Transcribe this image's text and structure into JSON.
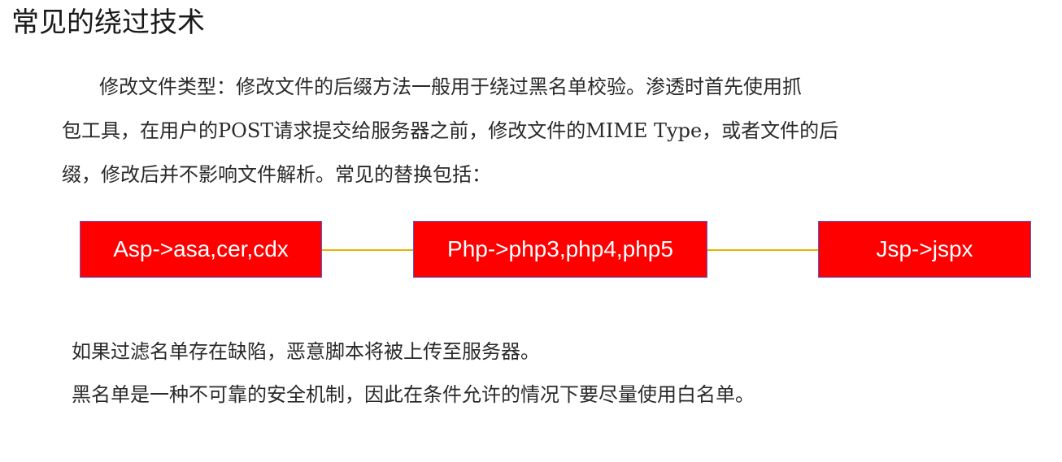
{
  "title": "常见的绕过技术",
  "paragraph": {
    "lines": [
      "修改文件类型：修改文件的后缀方法一般用于绕过黑名单校验。渗透时首先使用抓",
      "包工具，在用户的POST请求提交给服务器之前，修改文件的MIME Type，或者文件的后",
      "缀，修改后并不影响文件解析。常见的替换包括："
    ]
  },
  "flow": {
    "boxes": [
      {
        "label": "Asp->asa,cer,cdx"
      },
      {
        "label": "Php->php3,php4,php5"
      },
      {
        "label": "Jsp->jspx"
      }
    ],
    "colors": {
      "box_fill": "#ff0000",
      "box_text": "#ffffff",
      "connector": "#e8b300"
    }
  },
  "notes": [
    "如果过滤名单存在缺陷，恶意脚本将被上传至服务器。",
    "黑名单是一种不可靠的安全机制，因此在条件允许的情况下要尽量使用白名单。"
  ]
}
